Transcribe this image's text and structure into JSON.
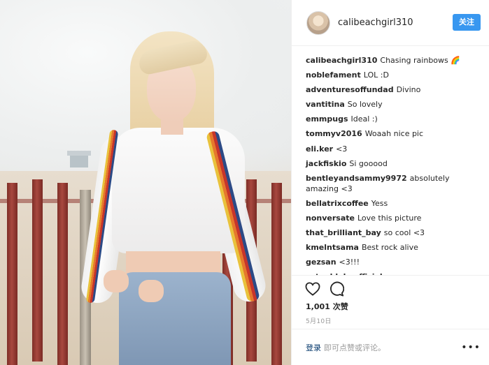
{
  "post": {
    "author": "calibeachgirl310",
    "follow_label": "关注"
  },
  "comments": [
    {
      "user": "calibeachgirl310",
      "text": "Chasing rainbows 🌈"
    },
    {
      "user": "noblefament",
      "text": "LOL :D"
    },
    {
      "user": "adventuresoffundad",
      "text": "Divino"
    },
    {
      "user": "vantitina",
      "text": "So lovely"
    },
    {
      "user": "emmpugs",
      "text": "Ideal :)"
    },
    {
      "user": "tommyv2016",
      "text": "Woaah nice pic"
    },
    {
      "user": "eli.ker",
      "text": "<3"
    },
    {
      "user": "jackfiskio",
      "text": "Si gooood"
    },
    {
      "user": "bentleyandsammy9972",
      "text": "absolutely amazing <3"
    },
    {
      "user": "bellatrixcoffee",
      "text": "Yess"
    },
    {
      "user": "nonversate",
      "text": "Love this picture"
    },
    {
      "user": "that_brilliant_bay",
      "text": "so cool <3"
    },
    {
      "user": "kmelntsama",
      "text": "Best rock alive"
    },
    {
      "user": "gezsan",
      "text": "<3!!!"
    },
    {
      "user": "esteghlal__official",
      "text": "wow"
    }
  ],
  "actions": {
    "like_icon": "heart-icon",
    "comment_icon": "comment-icon"
  },
  "likes": {
    "count": "1,001",
    "label": "次赞"
  },
  "date": "5月10日",
  "footer": {
    "login_label": "登录",
    "login_prompt": "即可点赞或评论。",
    "more_icon": "more-icon"
  },
  "colors": {
    "follow_button": "#3897f0",
    "link": "#003569",
    "muted": "#999999"
  }
}
